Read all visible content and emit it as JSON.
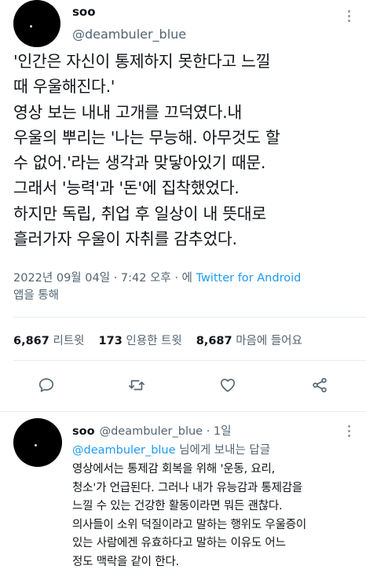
{
  "tweet": {
    "author_name": "soo",
    "author_handle": "@deambuler_blue",
    "text": "'인간은 자신이 통제하지 못한다고 느낄\n때 우울해진다.'\n영상 보는 내내 고개를 끄덕였다.내\n우울의 뿌리는 '나는 무능해. 아무것도 할\n수 없어.'라는 생각과 맞닿아있기 때문.\n그래서 '능력'과 '돈'에 집착했었다.\n하지만 독립, 취업 후 일상이 내 뜻대로\n흘러가자 우울이 자취를 감추었다.",
    "timestamp": "2022년 09월 04일 · 7:42 오후 · 에",
    "source": "Twitter for Android",
    "source_suffix": "앱을 통해"
  },
  "stats": {
    "retweets_count": "6,867",
    "retweets_label": "리트윗",
    "quotes_count": "173",
    "quotes_label": "인용한 트윗",
    "likes_count": "8,687",
    "likes_label": "마음에 들어요"
  },
  "actions": {
    "icons": [
      "reply-icon",
      "retweet-icon",
      "like-icon",
      "share-icon"
    ]
  },
  "reply": {
    "author_name": "soo",
    "author_handle": "@deambuler_blue",
    "time": "· 1일",
    "reply_to_handle": "@deambuler_blue",
    "reply_to_suffix": "님에게 보내는 답글",
    "text": "영상에서는 통제감 회복을 위해 '운동, 요리,\n청소'가 언급된다. 그러나 내가 유능감과 통제감을\n느낄 수 있는 건강한 활동이라면 뭐든 괜찮다.\n의사들이 소위 덕질이라고 말하는 행위도 우울증이\n있는 사람에겐 유효하다고 말하는 이유도 어느\n정도 맥락을 같이 한다."
  },
  "colors": {
    "link": "#1d9bf0",
    "secondary_text": "#536471",
    "primary_text": "#0f1419"
  }
}
